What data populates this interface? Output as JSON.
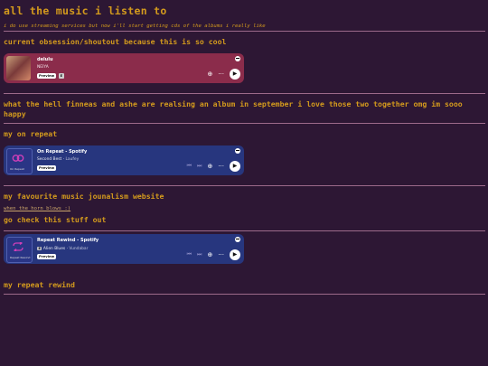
{
  "header": {
    "title": "all the music i listen to",
    "note": "i do use streaming services but now i'll start getting cds of the albums i really like"
  },
  "sections": {
    "obsession_heading": "current obsession/shoutout because this is so cool",
    "finneas_heading": "what the hell finneas and ashe are realsing an album in september i love those two together omg im sooo happy",
    "on_repeat_heading": "my on repeat",
    "journalism_heading": "my favourite music jounalism website",
    "journalism_link": "when the horn blows :)",
    "check_heading": "go check this stuff out",
    "rewind_heading": "my repeat rewind"
  },
  "embeds": {
    "delulu": {
      "title": "delulu",
      "artist": "NEIYA",
      "preview_label": "Preview",
      "explicit": "E"
    },
    "on_repeat": {
      "title": "On Repeat - Spotify",
      "track": "Second Best",
      "artist": "Laufey",
      "art_label": "On Repeat",
      "preview_label": "Preview"
    },
    "repeat_rewind": {
      "title": "Repeat Rewind - Spotify",
      "explicit": "E",
      "track": "Alien Blues",
      "artist": "Vundabar",
      "art_label": "Repeat Rewind",
      "preview_label": "Preview"
    }
  },
  "colors": {
    "background": "#2d1734",
    "text": "#d39a1d",
    "divider": "#9c6a8a",
    "delulu_embed": "#8b2c4b",
    "blue_embed": "#27367e",
    "loop_icon": "#cf3fb8"
  },
  "icons": [
    "spotify-logo-icon",
    "add-icon",
    "more-icon",
    "play-icon",
    "previous-icon",
    "next-icon",
    "loop-icon"
  ]
}
